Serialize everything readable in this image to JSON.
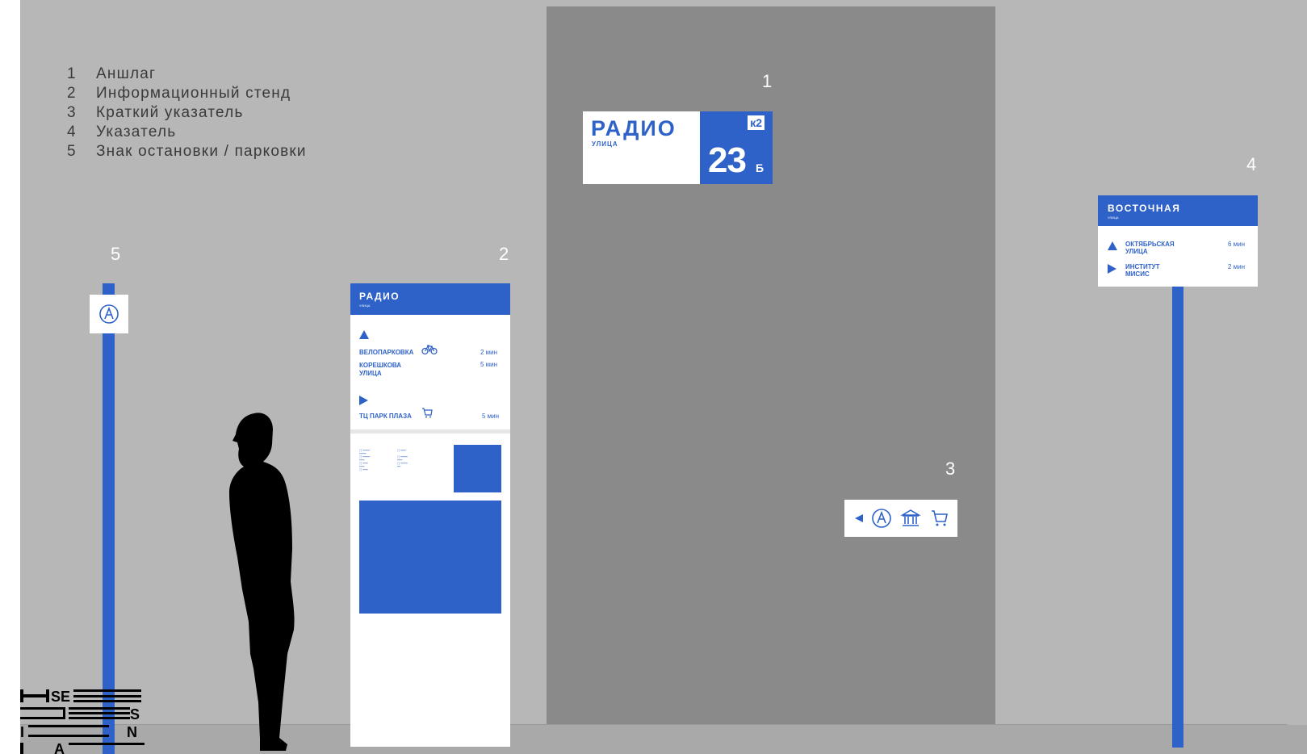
{
  "legend": [
    {
      "num": "1",
      "label": "Аншлаг"
    },
    {
      "num": "2",
      "label": "Информационный стенд"
    },
    {
      "num": "3",
      "label": "Краткий указатель"
    },
    {
      "num": "4",
      "label": "Указатель"
    },
    {
      "num": "5",
      "label": "Знак остановки / парковки"
    }
  ],
  "markers": {
    "m1": "1",
    "m2": "2",
    "m3": "3",
    "m4": "4",
    "m5": "5"
  },
  "sign1": {
    "street": "РАДИО",
    "street_type": "УЛИЦА",
    "number": "23",
    "letter": "Б",
    "korpus": "к2"
  },
  "sign2": {
    "street": "РАДИО",
    "street_type": "УЛИЦА",
    "dest1": "ВЕЛОПАРКОВКА",
    "dest1_time": "2 мин",
    "dest2": "КОРЕШКОВА УЛИЦА",
    "dest2_time": "5 мин",
    "dest3": "ТЦ ПАРК ПЛАЗА",
    "dest3_time": "5 мин"
  },
  "sign4": {
    "street": "ВОСТОЧНАЯ",
    "street_type": "УЛИЦА",
    "dest1": "ОКТЯБРЬСКАЯ УЛИЦА",
    "dest1_time": "6 мин",
    "dest2": "ИНСТИТУТ МИСИС",
    "dest2_time": "2 мин"
  },
  "logo": {
    "text": "HSE DESIGN LAB"
  },
  "colors": {
    "accent": "#2f62c9",
    "wall": "#b7b7b7",
    "building": "#8a8a8a"
  },
  "icons": [
    "arrow-left-icon",
    "parking-icon",
    "museum-icon",
    "cart-icon",
    "bicycle-icon"
  ]
}
